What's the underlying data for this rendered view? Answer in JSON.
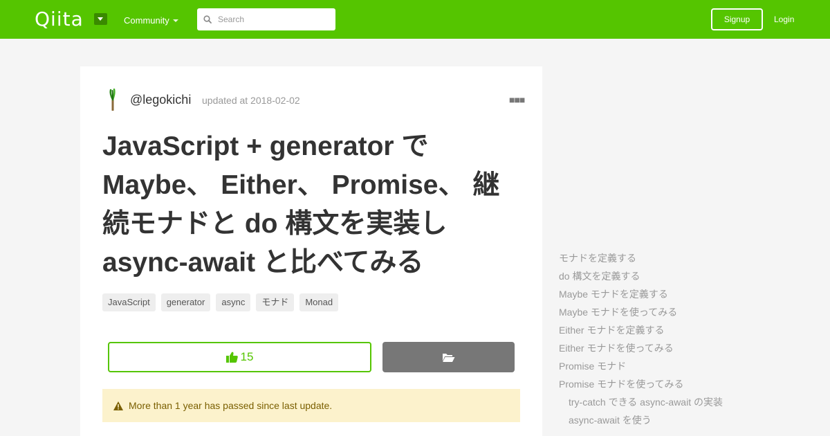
{
  "header": {
    "logo": "Qiita",
    "community_label": "Community",
    "search_placeholder": "Search",
    "signup_label": "Signup",
    "login_label": "Login",
    "brand_color": "#55c500"
  },
  "article": {
    "author": "@legokichi",
    "updated": "updated at 2018-02-02",
    "title_lines": [
      "JavaScript + generator で",
      "Maybe、 Either、 Promise、 継",
      "続モナドと do 構文を実装し",
      "async-await と比べてみる"
    ],
    "tags": [
      "JavaScript",
      "generator",
      "async",
      "モナド",
      "Monad"
    ],
    "like_count": "15",
    "alert_text": "More than 1 year has passed since last update."
  },
  "toc": {
    "items": [
      {
        "label": "モナドを定義する",
        "level": 1
      },
      {
        "label": "do 構文を定義する",
        "level": 1
      },
      {
        "label": "Maybe モナドを定義する",
        "level": 1
      },
      {
        "label": "Maybe モナドを使ってみる",
        "level": 1
      },
      {
        "label": "Either モナドを定義する",
        "level": 1
      },
      {
        "label": "Either モナドを使ってみる",
        "level": 1
      },
      {
        "label": "Promise モナド",
        "level": 1
      },
      {
        "label": "Promise モナドを使ってみる",
        "level": 1
      },
      {
        "label": "try-catch できる async-await の実装",
        "level": 2
      },
      {
        "label": "async-await を使う",
        "level": 2
      }
    ]
  }
}
